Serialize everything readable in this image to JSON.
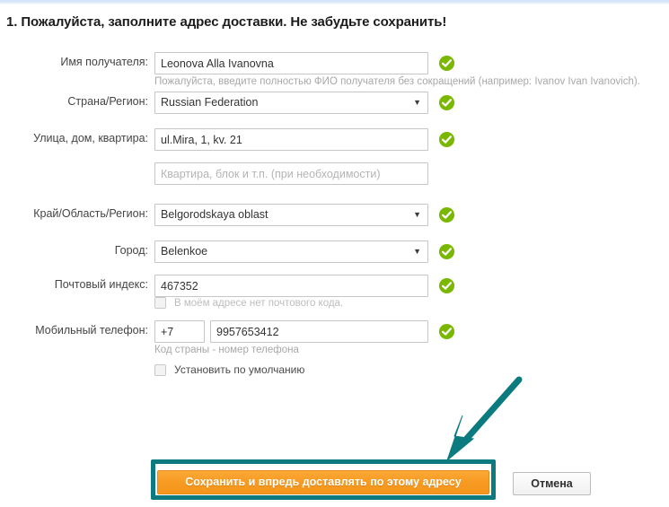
{
  "page": {
    "title": "1. Пожалуйста, заполните адрес доставки. Не забудьте сохранить!",
    "accent_teal": "#0b7b7f",
    "accent_orange": "#f79a21",
    "ok_green": "#7ab800"
  },
  "form": {
    "rows": [
      {
        "label": "Имя получателя:",
        "type": "text",
        "value": "Leonova Alla Ivanovna",
        "placeholder": "",
        "valid": true,
        "hint": "Пожалуйста, введите полностью ФИО получателя без сокращений (например: Ivanov Ivan Ivanovich)."
      },
      {
        "label": "Страна/Регион:",
        "type": "select",
        "value": "Russian Federation",
        "valid": true
      },
      {
        "label": "Улица, дом, квартира:",
        "type": "text",
        "value": "ul.Mira, 1, kv. 21",
        "placeholder": "",
        "valid": true
      },
      {
        "label": "",
        "type": "text",
        "value": "",
        "placeholder": "Квартира, блок и т.п. (при необходимости)",
        "valid": false
      },
      {
        "label": "Край/Область/Регион:",
        "type": "select",
        "value": "Belgorodskaya oblast",
        "valid": true
      },
      {
        "label": "Город:",
        "type": "select",
        "value": "Belenkoe",
        "valid": true
      },
      {
        "label": "Почтовый индекс:",
        "type": "text",
        "value": "467352",
        "placeholder": "",
        "valid": true,
        "checkbox": "В моём адресе нет почтового кода."
      },
      {
        "label": "Мобильный телефон:",
        "type": "phone",
        "country_code": "+7",
        "value": "9957653412",
        "valid": true,
        "hint": "Код страны - номер телефона"
      }
    ],
    "default_checkbox": "Установить по умолчанию"
  },
  "buttons": {
    "save": "Сохранить и впредь доставлять по этому адресу",
    "cancel": "Отмена"
  },
  "icons": {
    "check": "check-circle-icon",
    "caret": "▼",
    "arrow": "pointer-arrow-icon"
  }
}
